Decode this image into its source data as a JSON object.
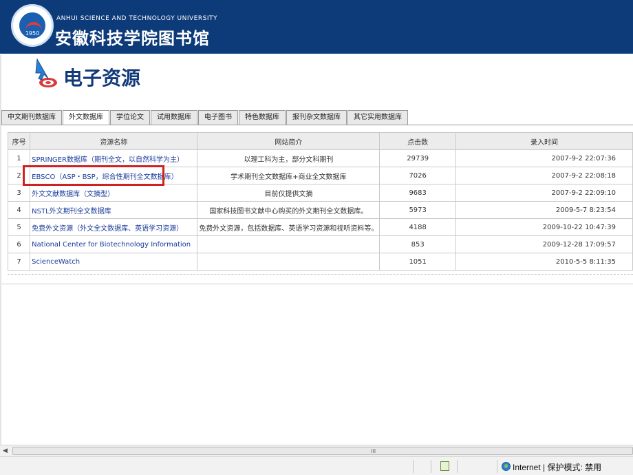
{
  "banner": {
    "university_en": "ANHUI SCIENCE AND TECHNOLOGY UNIVERSITY",
    "university_cn": "安徽科技学院图书馆",
    "logo_year": "1950"
  },
  "page_title": "电子资源",
  "tabs": [
    {
      "label": "中文期刊数据库"
    },
    {
      "label": "外文数据库",
      "active": true
    },
    {
      "label": "学位论文"
    },
    {
      "label": "试用数据库"
    },
    {
      "label": "电子图书"
    },
    {
      "label": "特色数据库"
    },
    {
      "label": "报刊杂文数据库"
    },
    {
      "label": "其它实用数据库"
    }
  ],
  "table": {
    "headers": [
      "序号",
      "资源名称",
      "网站简介",
      "点击数",
      "录入时间"
    ],
    "rows": [
      {
        "no": "1",
        "name": "SPRINGER数据库（期刊全文，以自然科学为主）",
        "desc": "以理工科为主，部分文科期刊",
        "hits": "29739",
        "date": "2007-9-2 22:07:36"
      },
      {
        "no": "2",
        "name": "EBSCO（ASP・BSP，综合性期刊全文数据库）",
        "desc": "学术期刊全文数据库+商业全文数据库",
        "hits": "7026",
        "date": "2007-9-2 22:08:18"
      },
      {
        "no": "3",
        "name": "外文文献数据库（文摘型）",
        "desc": "目前仅提供文摘",
        "hits": "9683",
        "date": "2007-9-2 22:09:10"
      },
      {
        "no": "4",
        "name": "NSTL外文期刊全文数据库",
        "desc": "国家科技图书文献中心购买的外文期刊全文数据库。",
        "hits": "5973",
        "date": "2009-5-7 8:23:54"
      },
      {
        "no": "5",
        "name": "免费外文资源（外文全文数据库、英语学习资源）",
        "desc": "免费外文资源，包括数据库、英语学习资源和视听资料等。",
        "hits": "4188",
        "date": "2009-10-22 10:47:39"
      },
      {
        "no": "6",
        "name": "National Center for Biotechnology Information",
        "desc": "",
        "hits": "853",
        "date": "2009-12-28 17:09:57"
      },
      {
        "no": "7",
        "name": "ScienceWatch",
        "desc": "",
        "hits": "1051",
        "date": "2010-5-5 8:11:35"
      }
    ]
  },
  "scrollbar": {
    "grip": "III"
  },
  "status": {
    "zone": "Internet | 保护模式: 禁用"
  },
  "colors": {
    "banner": "#0d3a78",
    "link": "#1a3c9a",
    "highlight": "#d02020"
  }
}
